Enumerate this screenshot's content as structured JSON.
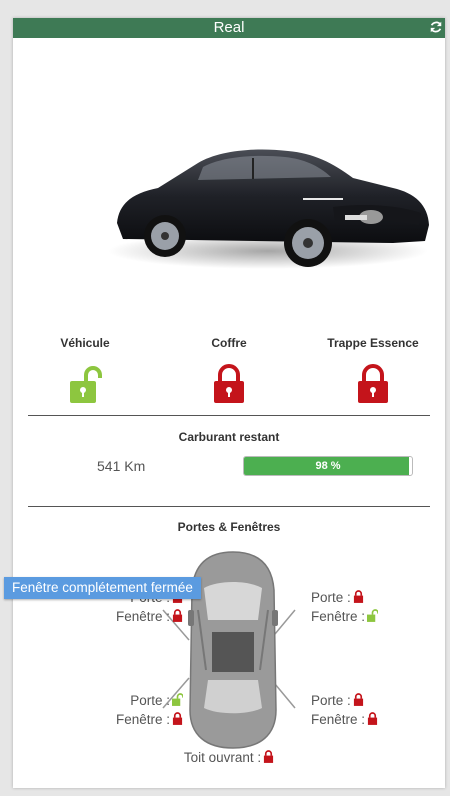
{
  "header": {
    "title": "Real",
    "refresh_icon": "refresh-icon"
  },
  "locks": [
    {
      "label": "Véhicule",
      "state": "unlocked",
      "color": "#8dc63f"
    },
    {
      "label": "Coffre",
      "state": "locked",
      "color": "#c4141b"
    },
    {
      "label": "Trappe Essence",
      "state": "locked",
      "color": "#c4141b"
    }
  ],
  "fuel": {
    "title": "Carburant restant",
    "range": "541 Km",
    "percent_label": "98 %",
    "percent": 98
  },
  "doors": {
    "title": "Portes & Fenêtres",
    "front_left": {
      "door_label": "Porte :",
      "door_state": "locked",
      "window_label": "Fenêtre :",
      "window_state": "locked"
    },
    "front_right": {
      "door_label": "Porte :",
      "door_state": "locked",
      "window_label": "Fenêtre :",
      "window_state": "unlocked"
    },
    "rear_left": {
      "door_label": "Porte :",
      "door_state": "unlocked",
      "window_label": "Fenêtre :",
      "window_state": "locked"
    },
    "rear_right": {
      "door_label": "Porte :",
      "door_state": "locked",
      "window_label": "Fenêtre :",
      "window_state": "locked"
    },
    "sunroof": {
      "label": "Toit ouvrant :",
      "state": "locked"
    }
  },
  "tooltip": {
    "text": "Fenêtre complétement fermée"
  },
  "colors": {
    "locked": "#c4141b",
    "unlocked": "#8dc63f",
    "header": "#3e7a55",
    "fuel": "#4caf50",
    "tooltip": "#5b9be0"
  }
}
